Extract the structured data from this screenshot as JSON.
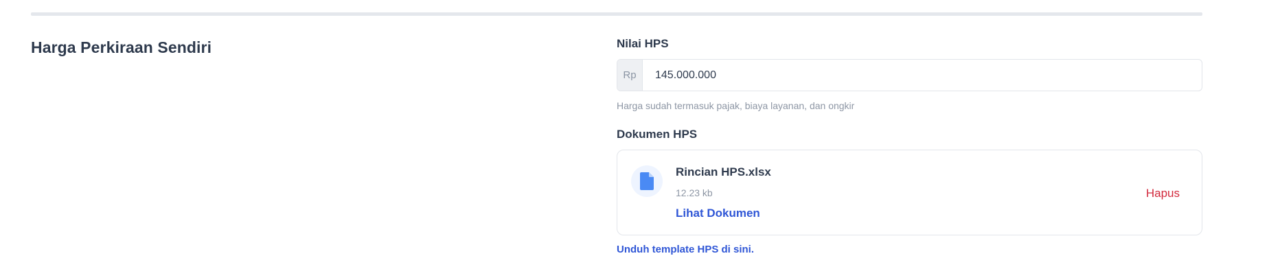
{
  "section": {
    "title": "Harga Perkiraan Sendiri"
  },
  "nilai_hps": {
    "label": "Nilai HPS",
    "prefix": "Rp",
    "value": "145.000.000",
    "helper": "Harga sudah termasuk pajak, biaya layanan, dan ongkir"
  },
  "dokumen_hps": {
    "label": "Dokumen HPS",
    "file": {
      "icon": "file-icon",
      "name": "Rincian HPS.xlsx",
      "size": "12.23 kb",
      "view_label": "Lihat Dokumen",
      "delete_label": "Hapus"
    },
    "template_link": "Unduh template HPS di sini."
  },
  "colors": {
    "link": "#2f56d6",
    "danger": "#d2293c",
    "icon": "#4a8af4"
  }
}
